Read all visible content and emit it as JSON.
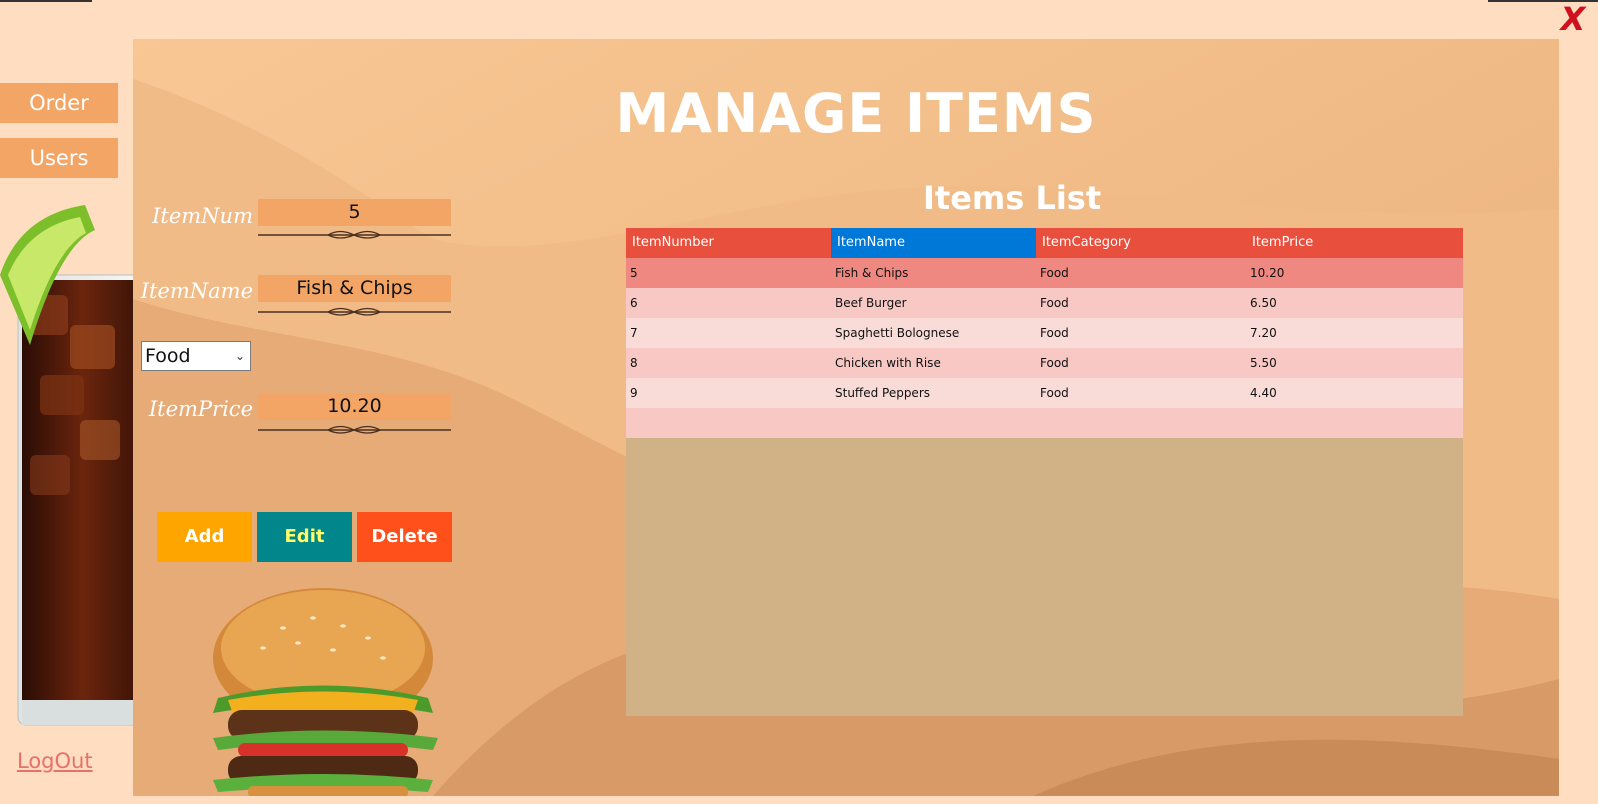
{
  "window": {
    "close_label": "X"
  },
  "nav": {
    "order_label": "Order",
    "users_label": "Users",
    "logout_label": "LogOut"
  },
  "page": {
    "title": "Manage Items"
  },
  "form": {
    "item_num_label": "ItemNum",
    "item_num_value": "5",
    "item_name_label": "ItemName",
    "item_name_value": "Fish & Chips",
    "category_selected": "Food",
    "item_price_label": "ItemPrice",
    "item_price_value": "10.20"
  },
  "actions": {
    "add_label": "Add",
    "edit_label": "Edit",
    "delete_label": "Delete"
  },
  "list": {
    "title": "Items List",
    "columns": [
      "ItemNumber",
      "ItemName",
      "ItemCategory",
      "ItemPrice"
    ],
    "selected_column": "ItemName",
    "rows": [
      [
        "5",
        "Fish & Chips",
        "Food",
        "10.20"
      ],
      [
        "6",
        "Beef Burger",
        "Food",
        "6.50"
      ],
      [
        "7",
        "Spaghetti Bolognese",
        "Food",
        "7.20"
      ],
      [
        "8",
        "Chicken with Rise",
        "Food",
        "5.50"
      ],
      [
        "9",
        "Stuffed Peppers",
        "Food",
        "4.40"
      ]
    ],
    "selected_row": 0
  },
  "colors": {
    "page_bg": "#FFDDC0",
    "accent": "#F3A566",
    "header_red": "#E84F3D",
    "header_selected_blue": "#0078D7",
    "add_orange": "#FFA500",
    "edit_teal": "#00868B",
    "edit_text_yellow": "#FFFF66",
    "delete_red": "#FF4F1A",
    "grid_empty": "#D1B287",
    "row_selected": "#EE8880",
    "row_light": "#F9DBD8",
    "row_mid": "#F7C8C4",
    "close_red": "#D0101E"
  },
  "icons": {
    "close": "close-x-icon",
    "dropdown": "chevron-down-icon"
  }
}
